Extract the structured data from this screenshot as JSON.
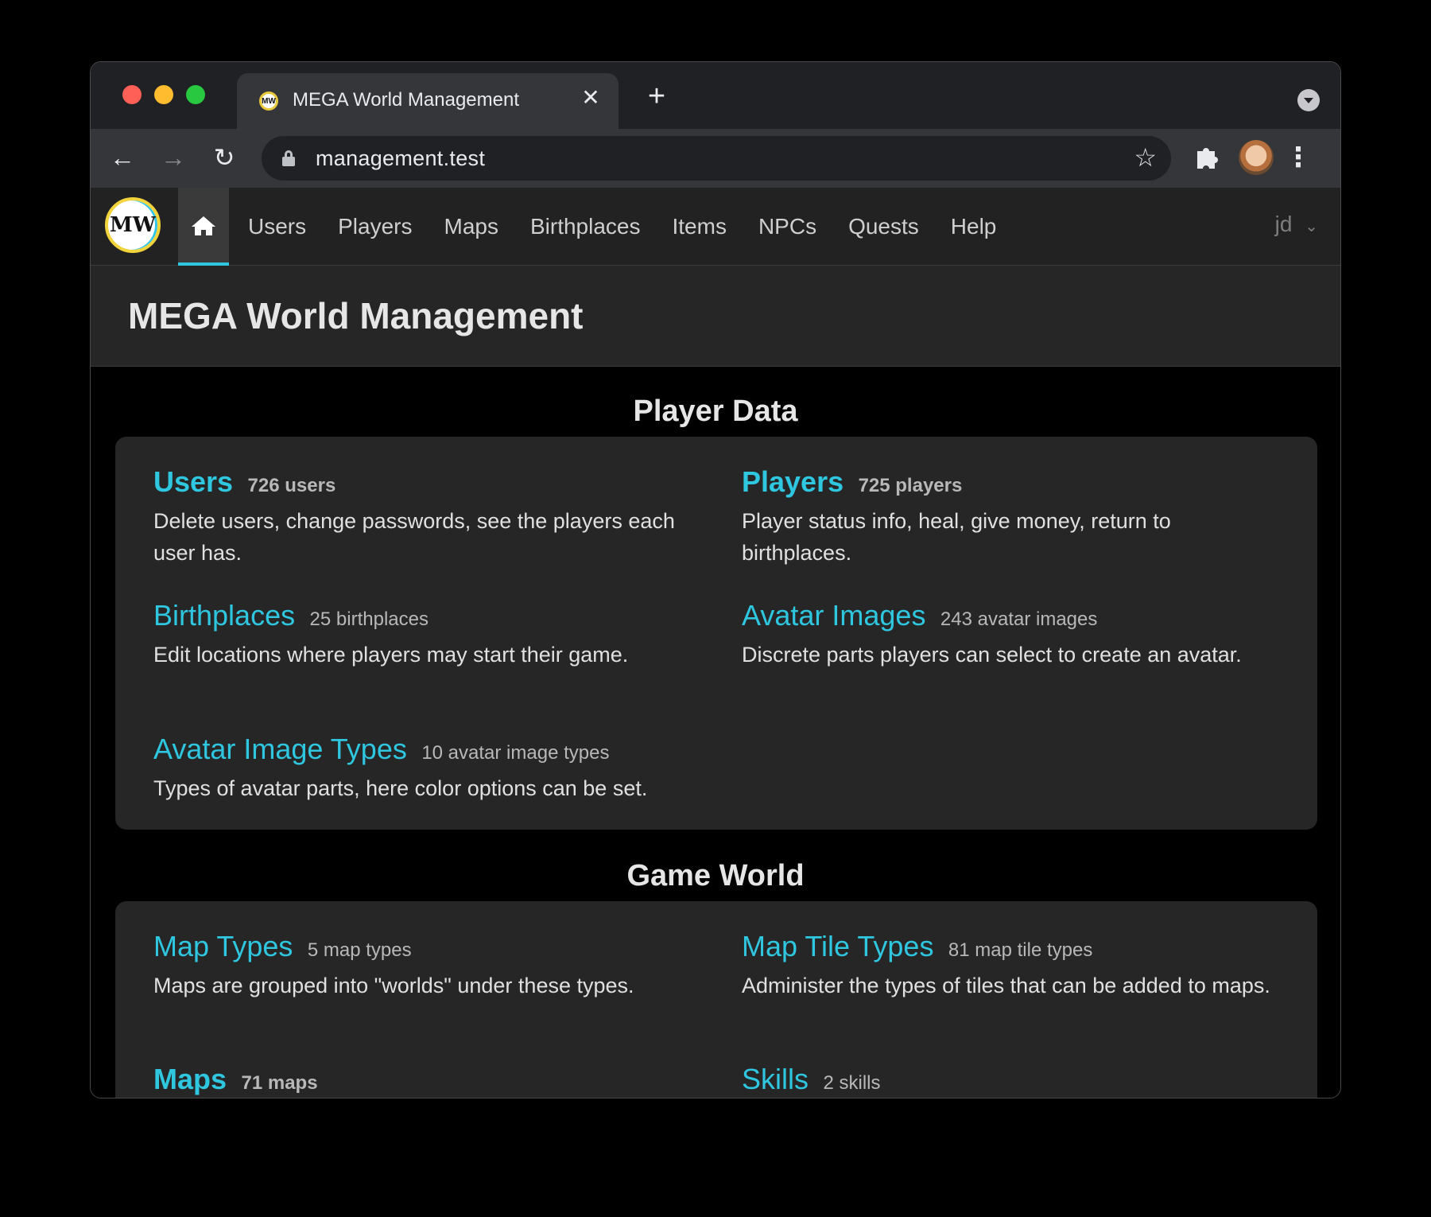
{
  "browser": {
    "tab_title": "MEGA World Management",
    "tab_favicon_text": "MW",
    "url": "management.test"
  },
  "navbar": {
    "logo_text": "MW",
    "links": [
      "Users",
      "Players",
      "Maps",
      "Birthplaces",
      "Items",
      "NPCs",
      "Quests",
      "Help"
    ],
    "user": "jd"
  },
  "hero": {
    "title": "MEGA World Management"
  },
  "sections": [
    {
      "title": "Player Data",
      "entries": [
        {
          "name": "Users",
          "count": "726 users",
          "desc": "Delete users, change passwords, see the players each user has."
        },
        {
          "name": "Players",
          "count": "725 players",
          "desc": "Player status info, heal, give money, return to birthplaces."
        },
        {
          "name": "Birthplaces",
          "count": "25 birthplaces",
          "desc": "Edit locations where players may start their game."
        },
        {
          "name": "Avatar Images",
          "count": "243 avatar images",
          "desc": "Discrete parts players can select to create an avatar."
        },
        {
          "name": "Avatar Image Types",
          "count": "10 avatar image types",
          "desc": "Types of avatar parts, here color options can be set."
        }
      ]
    },
    {
      "title": "Game World",
      "entries": [
        {
          "name": "Map Types",
          "count": "5 map types",
          "desc": "Maps are grouped into \"worlds\" under these types."
        },
        {
          "name": "Map Tile Types",
          "count": "81 map tile types",
          "desc": "Administer the types of tiles that can be added to maps."
        },
        {
          "name": "Maps",
          "count": "71 maps",
          "desc": ""
        },
        {
          "name": "Skills",
          "count": "2 skills",
          "desc": ""
        }
      ]
    }
  ],
  "colors": {
    "accent": "#2fc6e0",
    "background": "#000000",
    "card": "#262626",
    "navbar": "#222222"
  }
}
